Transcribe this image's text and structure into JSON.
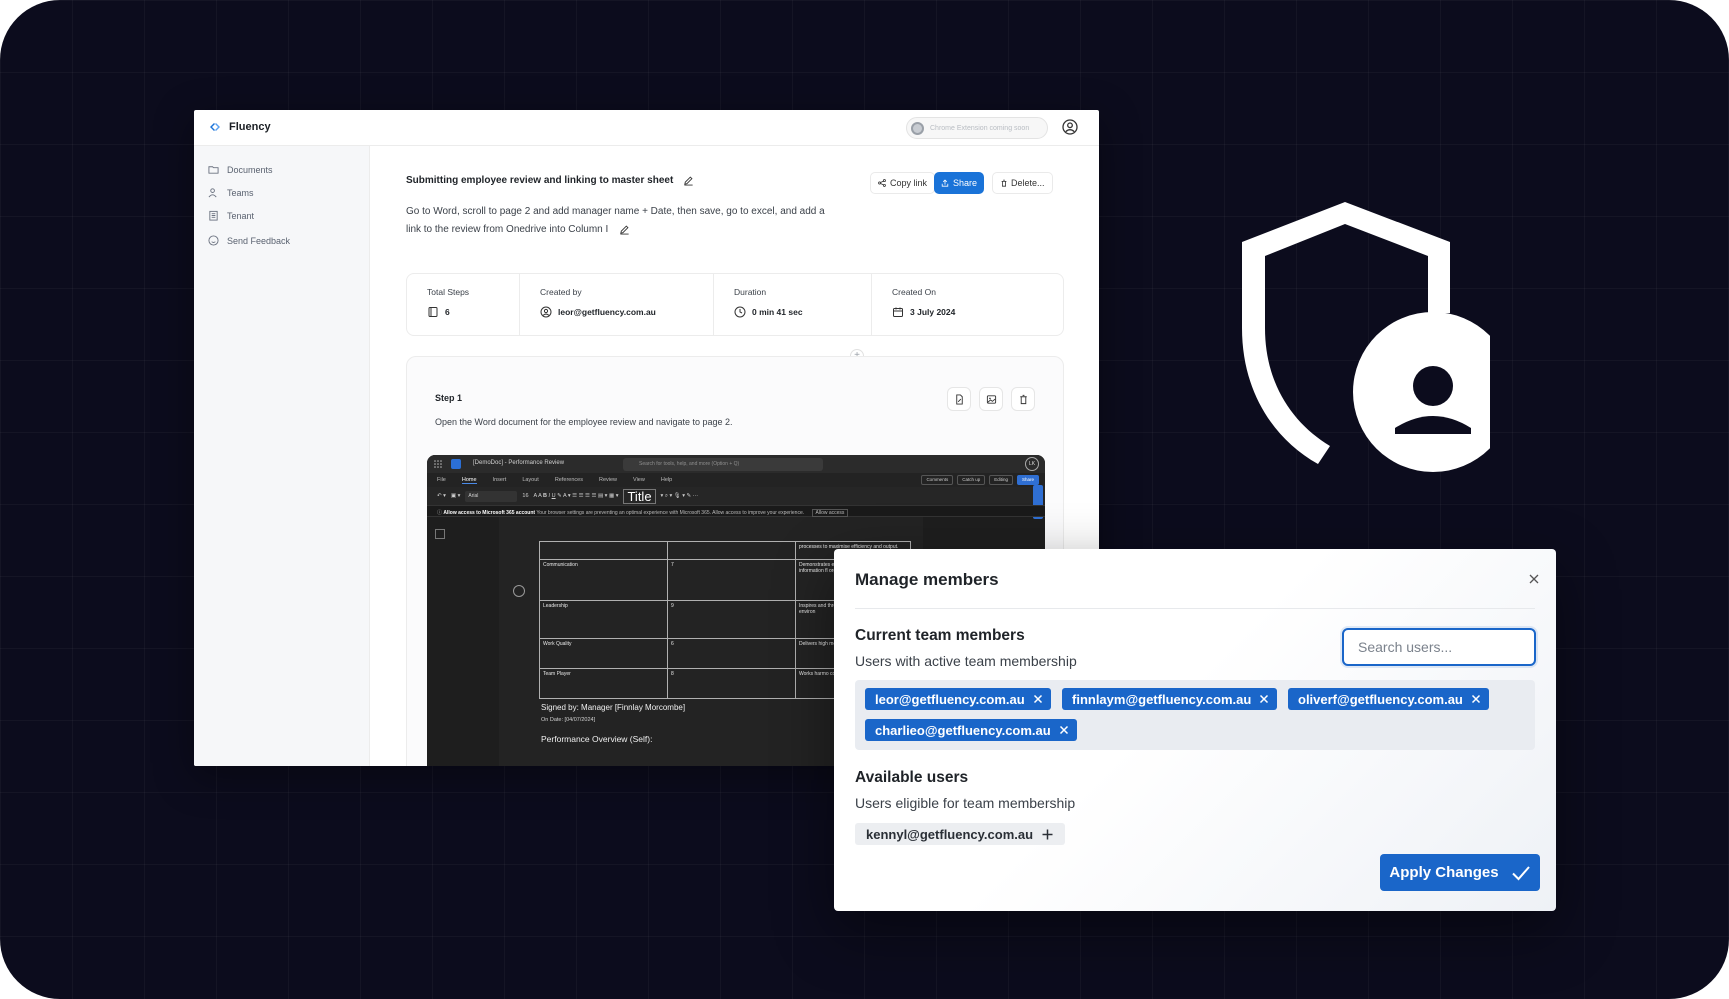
{
  "app": {
    "brand": "Fluency",
    "extension_pill": "Chrome Extension coming soon"
  },
  "sidebar": {
    "items": [
      {
        "label": "Documents",
        "icon": "folder-icon"
      },
      {
        "label": "Teams",
        "icon": "users-icon"
      },
      {
        "label": "Tenant",
        "icon": "building-icon"
      },
      {
        "label": "Send Feedback",
        "icon": "smile-icon"
      }
    ]
  },
  "document": {
    "title": "Submitting employee review and linking to master sheet",
    "description": "Go to Word, scroll to page 2 and add manager name + Date, then save, go to excel, and add a link to the review from Onedrive into Column I",
    "actions": {
      "copy_link": "Copy link",
      "share": "Share",
      "delete": "Delete..."
    },
    "stats": [
      {
        "label": "Total Steps",
        "value": "6",
        "icon": "book-icon"
      },
      {
        "label": "Created by",
        "value": "leor@getfluency.com.au",
        "icon": "user-circle-icon"
      },
      {
        "label": "Duration",
        "value": "0 min 41 sec",
        "icon": "clock-icon"
      },
      {
        "label": "Created On",
        "value": "3 July 2024",
        "icon": "calendar-icon"
      }
    ],
    "step": {
      "title": "Step 1",
      "description": "Open the Word document for the employee review and navigate to page 2."
    }
  },
  "word_screenshot": {
    "doc_name": "[DemoDoc] - Performance Review",
    "search": "Search for tools, help, and more (Option + Q)",
    "avatar": "LK",
    "menu": [
      "File",
      "Home",
      "Insert",
      "Layout",
      "References",
      "Review",
      "View",
      "Help"
    ],
    "menu_right": [
      "Comments",
      "Catch up",
      "Editing",
      "Share"
    ],
    "font": "Arial",
    "font_size": "16",
    "style": "Title",
    "notice_bold": "Allow access to Microsoft 365 account",
    "notice_text": "Your browser settings are preventing an optimal experience with Microsoft 365. Allow access to improve your experience.",
    "notice_button": "Allow access",
    "table": [
      [
        "",
        "",
        "processes to maximise efficiency and output."
      ],
      [
        "Communication",
        "7",
        "Demonstrates effectiveness communicati information fl organisation."
      ],
      [
        "Leadership",
        "9",
        "Inspires and through a col high performi work environ"
      ],
      [
        "Work Quality",
        "6",
        "Delivers high meticulous at the highest st"
      ],
      [
        "Team Player",
        "8",
        "Works harmo contributing supportive te"
      ]
    ],
    "signed": "Signed by: Manager [Finnlay Morcombe]",
    "date": "On Date: [04/07/2024]",
    "overview": "Performance Overview (Self):"
  },
  "modal": {
    "title": "Manage members",
    "current_title": "Current team members",
    "current_subtitle": "Users with active team membership",
    "search_placeholder": "Search users...",
    "members": [
      "leor@getfluency.com.au",
      "finnlaym@getfluency.com.au",
      "oliverf@getfluency.com.au",
      "charlieo@getfluency.com.au"
    ],
    "available_title": "Available users",
    "available_subtitle": "Users eligible for team membership",
    "available": [
      "kennyl@getfluency.com.au"
    ],
    "apply_label": "Apply Changes"
  },
  "colors": {
    "background": "#0c0c1d",
    "accent": "#1a66c9",
    "share_button": "#1a73d8"
  }
}
